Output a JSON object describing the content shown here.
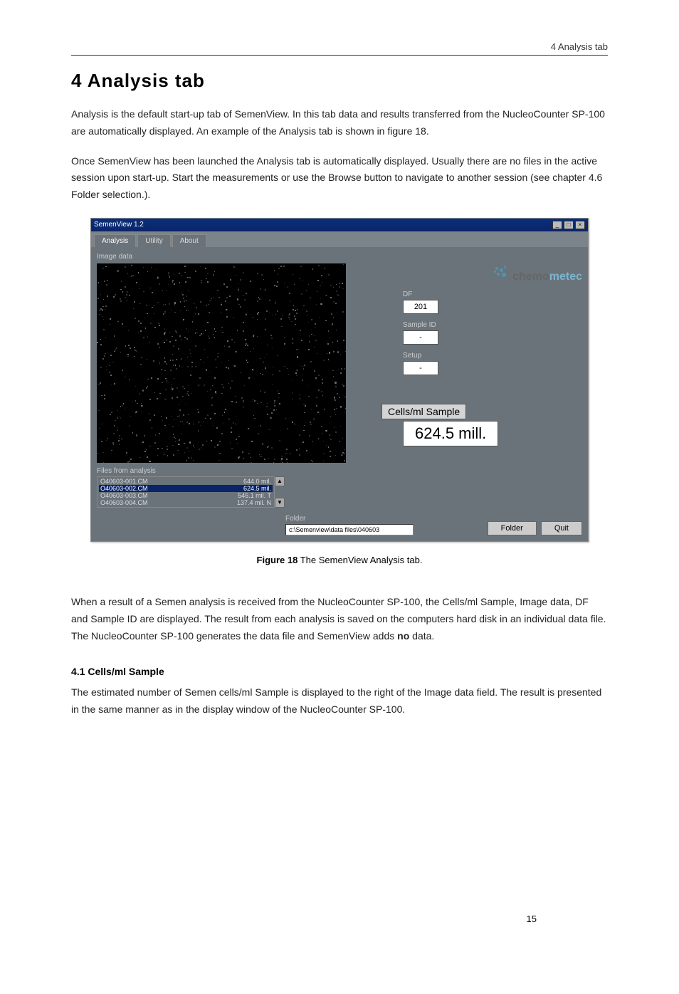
{
  "header": {
    "section": "4 Analysis tab"
  },
  "title": "4  Analysis tab",
  "para1": "Analysis is the default start-up tab of SemenView. In this tab data and results transferred from the NucleoCounter SP-100 are automatically displayed. An example of the Analysis tab is shown in figure 18.",
  "para2": "Once SemenView has been launched the Analysis tab is automatically displayed. Usually there are no files in the active session upon start-up. Start the measurements or use the Browse button to navigate to another session (see chapter 4.6 Folder selection.).",
  "app": {
    "title": "SemenView 1.2",
    "tabs": [
      "Analysis",
      "Utility",
      "About"
    ],
    "imageDataLabel": "Image data",
    "logo_chemo": "chemo",
    "logo_metec": "metec",
    "fields": {
      "df_label": "DF",
      "df_value": "201",
      "sampleid_label": "Sample ID",
      "sampleid_value": "-",
      "setup_label": "Setup",
      "setup_value": "-"
    },
    "cells_label": "Cells/ml Sample",
    "cells_value": "624.5 mill.",
    "files_label": "Files from analysis",
    "files": [
      {
        "name": "O40603-001.CM",
        "val": "644.0 mil."
      },
      {
        "name": "O40603-002.CM",
        "val": "624.5 mil."
      },
      {
        "name": "O40603-003.CM",
        "val": "545.1 mil. T"
      },
      {
        "name": "O40603-004.CM",
        "val": "137.4 mil. N"
      }
    ],
    "folder_label": "Folder",
    "folder_path": "c:\\Semenview\\data files\\040603",
    "folder_btn": "Folder",
    "quit_btn": "Quit"
  },
  "figure_caption_bold": "Figure 18",
  "figure_caption_rest": " The SemenView Analysis tab.",
  "para3_part1": "When a result of a Semen analysis is received from the NucleoCounter SP-100, the Cells/ml Sample, Image data, DF and Sample ID are displayed. The result from each analysis is saved on the computers hard disk in an individual data file. The NucleoCounter SP-100 generates the data file and SemenView adds ",
  "para3_bold": "no",
  "para3_part2": " data.",
  "subsection": "4.1    Cells/ml Sample",
  "para4": "The estimated number of Semen cells/ml Sample is displayed to the right of the Image data field. The result is presented in the same manner as in the display window of the NucleoCounter SP-100.",
  "page_number": "15"
}
